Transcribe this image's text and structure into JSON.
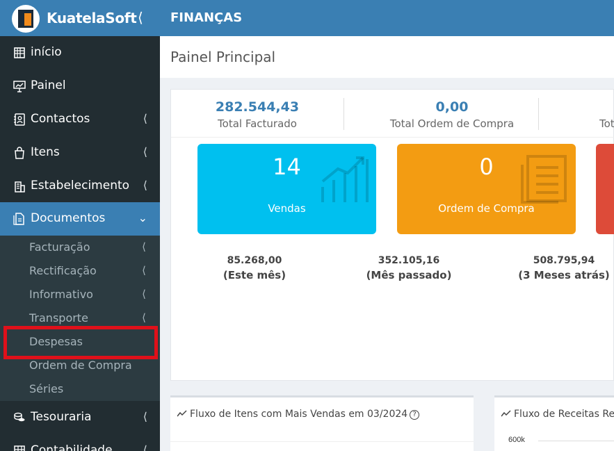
{
  "app": {
    "brand": "KuatelaSoft",
    "section": "FINANÇAS"
  },
  "colors": {
    "topbar": "#3a7fb3",
    "sidebar": "#222d32",
    "submenu": "#2c3b41",
    "tile_sales": "#00c0ef",
    "tile_orders": "#f39c12",
    "tile_third": "#dd4b39",
    "highlight": "#e0101a"
  },
  "sidebar": {
    "items": [
      {
        "label": "início",
        "icon": "building-grid-icon"
      },
      {
        "label": "Painel",
        "icon": "presentation-chart-icon"
      },
      {
        "label": "Contactos",
        "icon": "address-book-icon"
      },
      {
        "label": "Itens",
        "icon": "shopping-bag-icon"
      },
      {
        "label": "Estabelecimento",
        "icon": "building-icon"
      },
      {
        "label": "Documentos",
        "icon": "documents-icon"
      },
      {
        "label": "Tesouraria",
        "icon": "coins-icon"
      },
      {
        "label": "Contabilidade",
        "icon": "ledger-icon"
      }
    ],
    "documentos_sub": [
      {
        "label": "Facturação"
      },
      {
        "label": "Rectificação"
      },
      {
        "label": "Informativo"
      },
      {
        "label": "Transporte"
      },
      {
        "label": "Despesas"
      },
      {
        "label": "Ordem de Compra"
      },
      {
        "label": "Séries"
      }
    ]
  },
  "page": {
    "title": "Painel Principal"
  },
  "stats": [
    {
      "value": "282.544,43",
      "caption": "Total Facturado"
    },
    {
      "value": "0,00",
      "caption": "Total Ordem de Compra"
    },
    {
      "value": "",
      "caption": "Tot"
    }
  ],
  "tiles": [
    {
      "value": "14",
      "caption": "Vendas",
      "icon": "chart-trend-icon"
    },
    {
      "value": "0",
      "caption": "Ordem de Compra",
      "icon": "document-list-icon"
    }
  ],
  "periods": [
    {
      "value": "85.268,00",
      "label": "(Este mês)"
    },
    {
      "value": "352.105,16",
      "label": "(Mês passado)"
    },
    {
      "value": "508.795,94",
      "label": "(3 Meses atrás)"
    }
  ],
  "cards": [
    {
      "title": "Fluxo de Itens com Mais Vendas em 03/2024"
    },
    {
      "title": "Fluxo de Receitas Re",
      "axis_label": "600k"
    }
  ]
}
